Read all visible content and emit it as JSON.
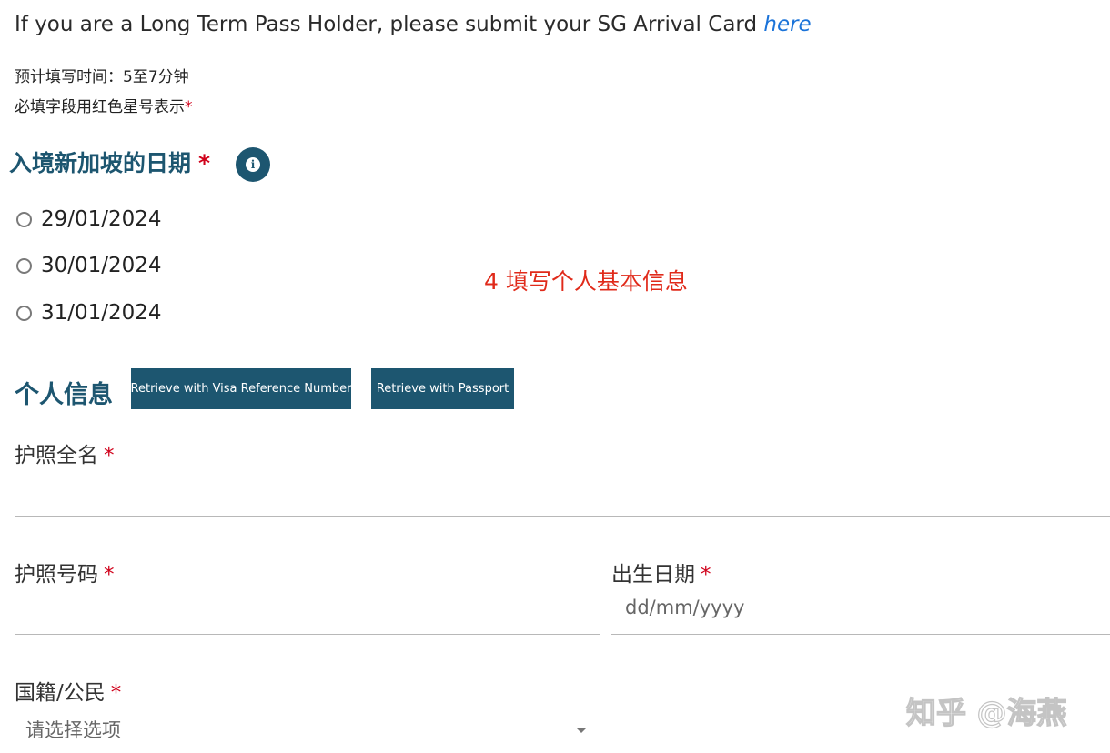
{
  "intro": {
    "text": "If you are a Long Term Pass Holder, please submit your SG Arrival Card ",
    "link_text": "here"
  },
  "hints": {
    "time_estimate": "预计填写时间：5至7分钟",
    "required_note": "必填字段用红色星号表示",
    "required_marker": "*"
  },
  "arrival_date": {
    "title": "入境新加坡的日期",
    "required": "*",
    "info_icon": "info-icon",
    "options": [
      "29/01/2024",
      "30/01/2024",
      "31/01/2024"
    ]
  },
  "annotation": "4 填写个人基本信息",
  "personal": {
    "title": "个人信息",
    "btn_visa": "Retrieve with Visa Reference Number",
    "btn_passport": "Retrieve with Passport"
  },
  "fields": {
    "passport_name": {
      "label": "护照全名",
      "required": "*",
      "value": ""
    },
    "passport_number": {
      "label": "护照号码",
      "required": "*",
      "value": ""
    },
    "dob": {
      "label": "出生日期",
      "required": "*",
      "placeholder": "dd/mm/yyyy"
    },
    "nationality": {
      "label": "国籍/公民",
      "required": "*",
      "selected": "请选择选项",
      "icon": "chevron-down-icon"
    }
  },
  "watermark": "知乎 @海燕",
  "colors": {
    "brand": "#1d5670",
    "required": "#d0021b",
    "link": "#1a73d9",
    "annotation": "#e02a1a"
  }
}
